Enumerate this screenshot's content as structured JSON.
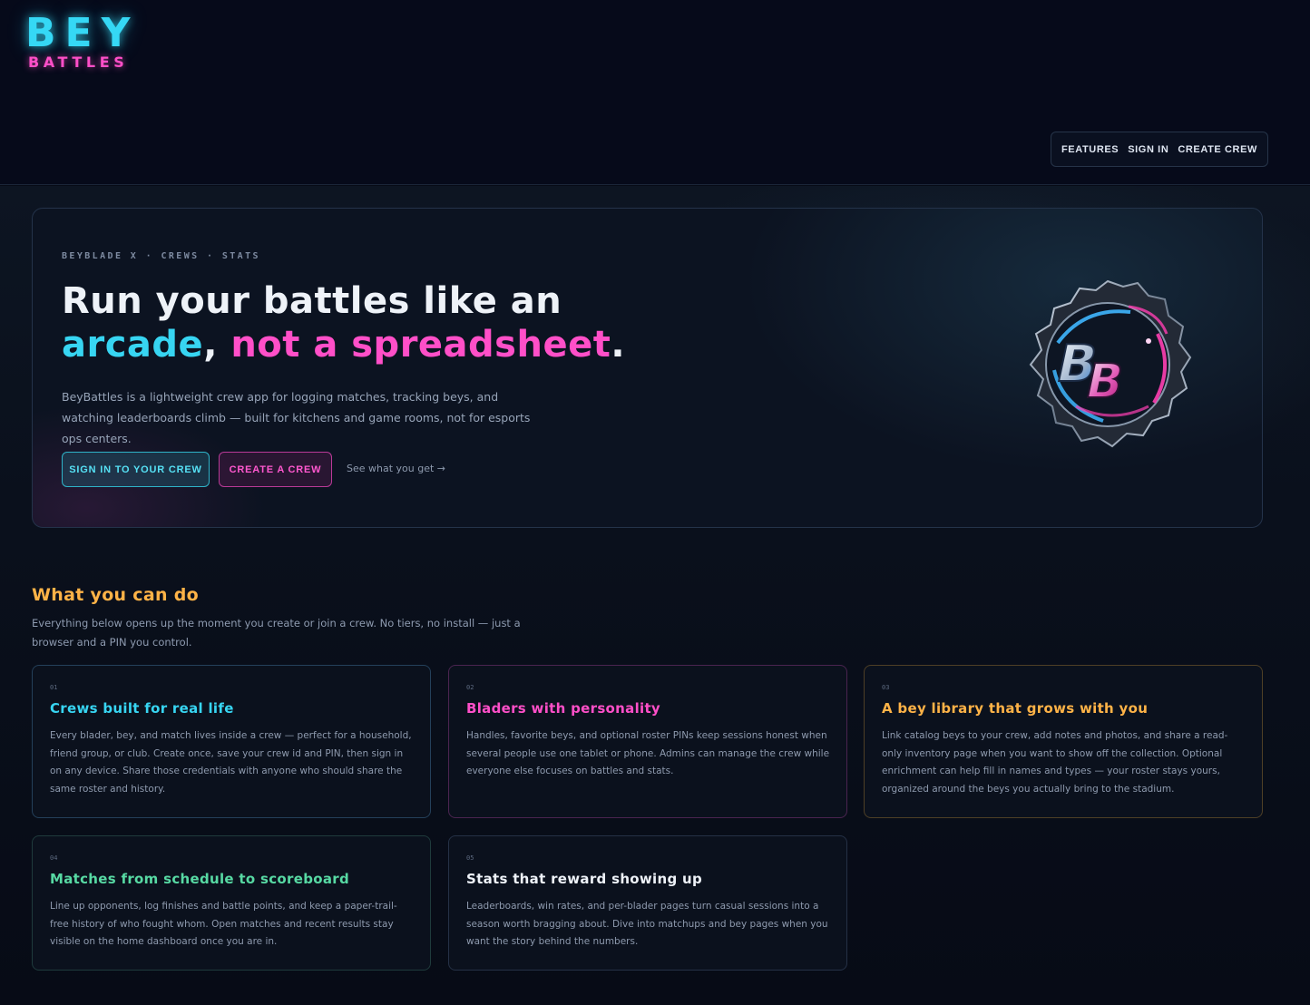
{
  "brand": {
    "logo_top": "BEY",
    "logo_bottom": "BATTLES"
  },
  "nav": {
    "features": "FEATURES",
    "sign_in": "SIGN IN",
    "create_crew": "CREATE CREW"
  },
  "hero": {
    "eyebrow": "BEYBLADE X · CREWS · STATS",
    "title_line1": "Run your battles like an",
    "title_word_arcade": "arcade",
    "title_comma": ",",
    "title_word_spreadsheet": "not a spreadsheet",
    "title_period": ".",
    "description": "BeyBattles is a lightweight crew app for logging matches, tracking beys, and watching leaderboards climb — built for kitchens and game rooms, not for esports ops centers.",
    "primary_button": "SIGN IN TO YOUR CREW",
    "secondary_button": "CREATE A CREW",
    "link": "See what you get →",
    "emblem_letters": "BB"
  },
  "features": {
    "title": "What you can do",
    "description": "Everything below opens up the moment you create or join a crew. No tiers, no install — just a browser and a PIN you control.",
    "cards": [
      {
        "num": "01",
        "title": "Crews built for real life",
        "color": "#37d5f2",
        "body": "Every blader, bey, and match lives inside a crew — perfect for a household, friend group, or club. Create once, save your crew id and PIN, then sign in on any device. Share those credentials with anyone who should share the same roster and history."
      },
      {
        "num": "02",
        "title": "Bladers with personality",
        "color": "#ff4fc8",
        "body": "Handles, favorite beys, and optional roster PINs keep sessions honest when several people use one tablet or phone. Admins can manage the crew while everyone else focuses on battles and stats."
      },
      {
        "num": "03",
        "title": "A bey library that grows with you",
        "color": "#ffb347",
        "body": "Link catalog beys to your crew, add notes and photos, and share a read-only inventory page when you want to show off the collection. Optional enrichment can help fill in names and types — your roster stays yours, organized around the beys you actually bring to the stadium."
      },
      {
        "num": "04",
        "title": "Matches from schedule to scoreboard",
        "color": "#57d9a3",
        "body": "Line up opponents, log finishes and battle points, and keep a paper-trail-free history of who fought whom. Open matches and recent results stay visible on the home dashboard once you are in."
      },
      {
        "num": "05",
        "title": "Stats that reward showing up",
        "color": "#eef2f8",
        "body": "Leaderboards, win rates, and per-blader pages turn casual sessions into a season worth bragging about. Dive into matchups and bey pages when you want the story behind the numbers."
      }
    ]
  }
}
